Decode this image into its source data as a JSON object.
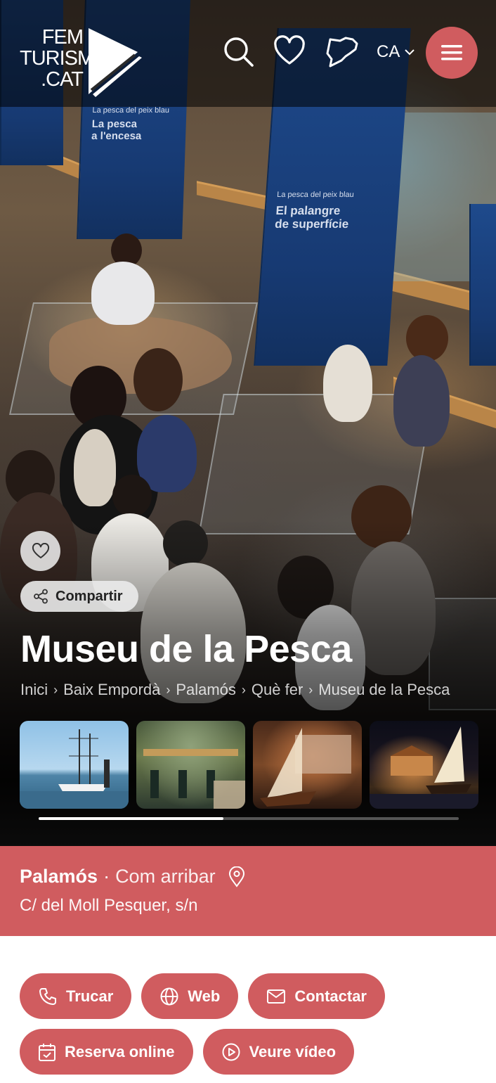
{
  "header": {
    "logo_lines": [
      "FEM",
      "TURISME",
      ".CAT"
    ],
    "language": "CA",
    "icons": [
      "search-icon",
      "heart-icon",
      "catalonia-map-icon",
      "chevron-down-icon",
      "hamburger-menu-icon"
    ]
  },
  "hero": {
    "share_label": "Compartir",
    "title": "Museu de la Pesca",
    "breadcrumbs": [
      "Inici",
      "Baix Empordà",
      "Palamós",
      "Què fer",
      "Museu de la Pesca"
    ],
    "banners": [
      {
        "lines": [
          "La pesca del peix blau",
          "La pesca",
          "a l'encesa"
        ]
      },
      {
        "lines": [
          "La pesca del peix blau",
          "El palangre",
          "de superfície"
        ]
      }
    ],
    "gallery_progress": 0.44
  },
  "location": {
    "town": "Palamós",
    "how_to_get": "Com arribar",
    "address": "C/ del Moll Pesquer, s/n"
  },
  "actions": {
    "call": "Trucar",
    "web": "Web",
    "contact": "Contactar",
    "booking": "Reserva online",
    "video": "Veure vídeo"
  },
  "colors": {
    "accent": "#d05c5f",
    "white": "#ffffff"
  }
}
